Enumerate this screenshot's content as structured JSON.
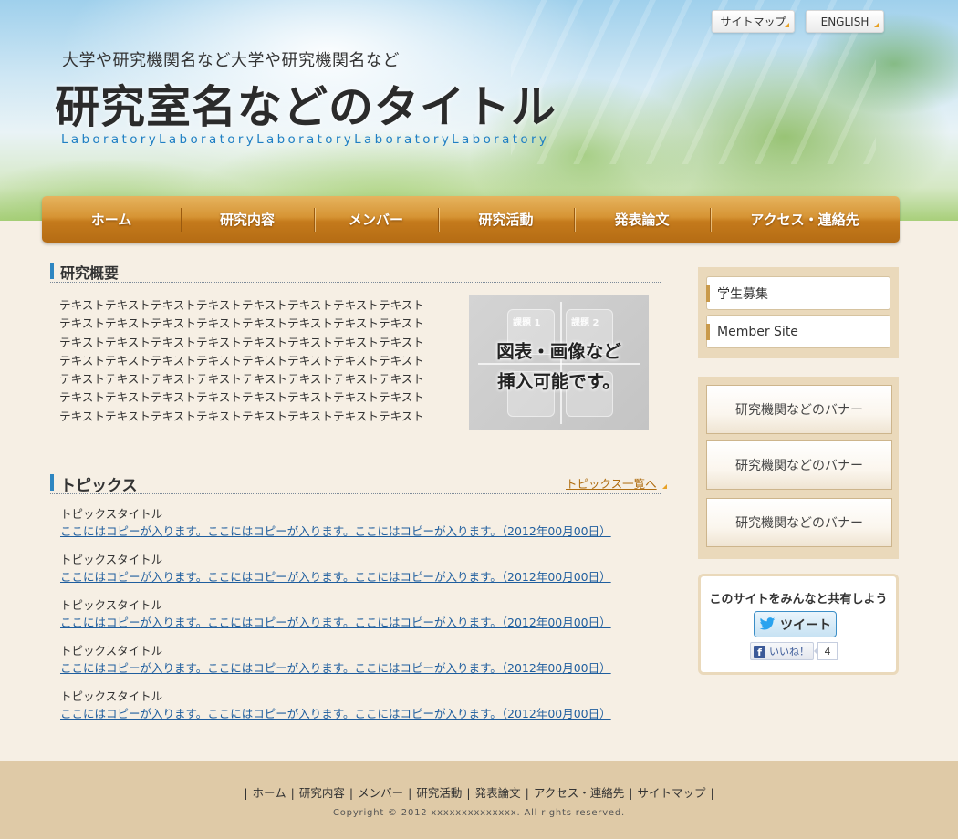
{
  "header": {
    "sub_title": "大学や研究機関名など大学や研究機関名など",
    "main_title": "研究室名などのタイトル",
    "lab_title": "LaboratoryLaboratoryLaboratoryLaboratoryLaboratory",
    "sitemap_label": "サイトマップ",
    "english_label": "ENGLISH"
  },
  "nav": {
    "items": [
      {
        "label": "ホーム"
      },
      {
        "label": "研究内容"
      },
      {
        "label": "メンバー"
      },
      {
        "label": "研究活動"
      },
      {
        "label": "発表論文"
      },
      {
        "label": "アクセス・連絡先"
      }
    ]
  },
  "overview": {
    "heading": "研究概要",
    "lines": [
      "テキストテキストテキストテキストテキストテキストテキストテキスト",
      "テキストテキストテキストテキストテキストテキストテキストテキスト",
      "テキストテキストテキストテキストテキストテキストテキストテキスト",
      "テキストテキストテキストテキストテキストテキストテキストテキスト",
      "テキストテキストテキストテキストテキストテキストテキストテキスト",
      "テキストテキストテキストテキストテキストテキストテキストテキスト",
      "テキストテキストテキストテキストテキストテキストテキストテキスト"
    ],
    "figure": {
      "caption_line1": "図表・画像など",
      "caption_line2": "挿入可能です。",
      "q1": "課題 1",
      "q2": "課題 2"
    }
  },
  "topics": {
    "heading": "トピックス",
    "list_link": "トピックス一覧へ",
    "items": [
      {
        "title": "トピックスタイトル",
        "link": "ここにはコピーが入ります。ここにはコピーが入ります。ここにはコピーが入ります。（2012年00月00日）"
      },
      {
        "title": "トピックスタイトル",
        "link": "ここにはコピーが入ります。ここにはコピーが入ります。ここにはコピーが入ります。（2012年00月00日）"
      },
      {
        "title": "トピックスタイトル",
        "link": "ここにはコピーが入ります。ここにはコピーが入ります。ここにはコピーが入ります。（2012年00月00日）"
      },
      {
        "title": "トピックスタイトル",
        "link": "ここにはコピーが入ります。ここにはコピーが入ります。ここにはコピーが入ります。（2012年00月00日）"
      },
      {
        "title": "トピックスタイトル",
        "link": "ここにはコピーが入ります。ここにはコピーが入ります。ここにはコピーが入ります。（2012年00月00日）"
      }
    ]
  },
  "sidebar": {
    "links": [
      {
        "label": "学生募集"
      },
      {
        "label": "Member Site"
      }
    ],
    "banners": [
      {
        "label": "研究機関などのバナー"
      },
      {
        "label": "研究機関などのバナー"
      },
      {
        "label": "研究機関などのバナー"
      }
    ],
    "share": {
      "title": "このサイトをみんなと共有しよう",
      "tweet_label": "ツイート",
      "like_label": "いいね！",
      "like_count": "4"
    }
  },
  "footer": {
    "links": [
      "ホーム",
      "研究内容",
      "メンバー",
      "研究活動",
      "発表論文",
      "アクセス・連絡先",
      "サイトマップ"
    ],
    "copyright": "Copyright © 2012 xxxxxxxxxxxxxx. All rights reserved."
  },
  "colors": {
    "accent_blue": "#2e86c1",
    "nav_orange": "#d69434",
    "link_blue": "#1f5e9e",
    "sidebar_beige": "#ead9bb",
    "footer_beige": "#dfcaa7"
  }
}
